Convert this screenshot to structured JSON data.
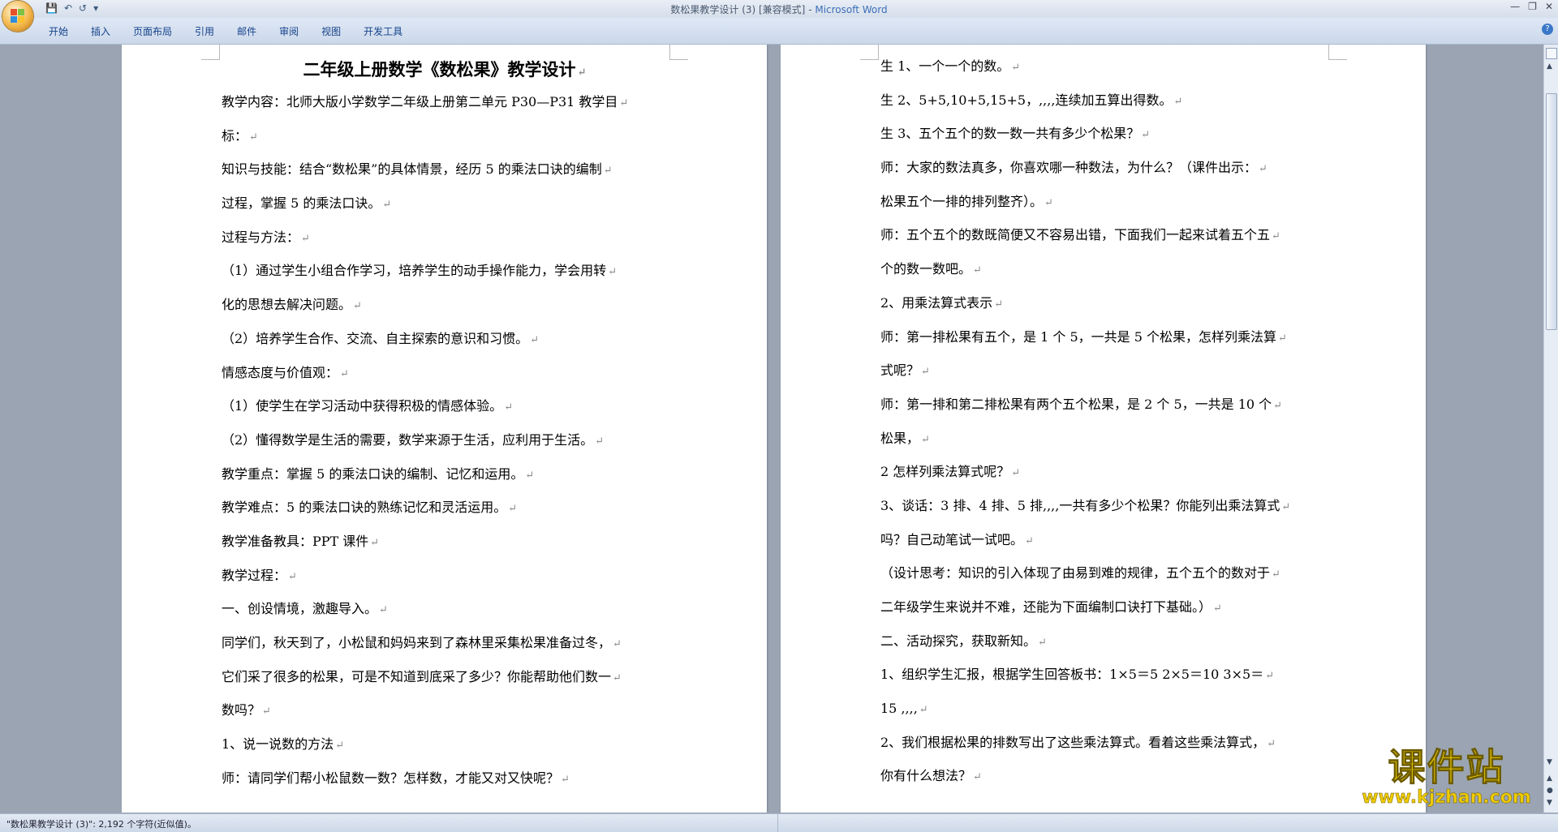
{
  "window": {
    "title": "数松果教学设计 (3) [兼容模式]",
    "separator": " - ",
    "app_name": "Microsoft Word"
  },
  "quick_access": {
    "save_icon": "save-icon",
    "undo_icon": "undo-icon",
    "redo_icon": "redo-icon",
    "customize_icon": "customize-icon"
  },
  "ribbon": {
    "tabs": [
      "开始",
      "插入",
      "页面布局",
      "引用",
      "邮件",
      "审阅",
      "视图",
      "开发工具"
    ]
  },
  "document": {
    "title": "二年级上册数学《数松果》教学设计",
    "left_lines": [
      " 教学内容：北师大版小学数学二年级上册第二单元 P30—P31 教学目",
      "标：",
      "知识与技能：结合“数松果”的具体情景，经历 5 的乘法口诀的编制",
      "过程，掌握 5 的乘法口诀。",
      "过程与方法：",
      "（1）通过学生小组合作学习，培养学生的动手操作能力，学会用转",
      "化的思想去解决问题。",
      "（2）培养学生合作、交流、自主探索的意识和习惯。",
      " 情感态度与价值观：",
      "（1）使学生在学习活动中获得积极的情感体验。",
      "（2）懂得数学是生活的需要，数学来源于生活，应利用于生活。",
      " 教学重点：掌握 5 的乘法口诀的编制、记忆和运用。",
      " 教学难点：5 的乘法口诀的熟练记忆和灵活运用。",
      "教学准备教具：PPT 课件",
      "教学过程：",
      "一、创设情境，激趣导入。",
      "同学们，秋天到了，小松鼠和妈妈来到了森林里采集松果准备过冬，",
      "它们采了很多的松果，可是不知道到底采了多少？你能帮助他们数一",
      "数吗？",
      "1、说一说数的方法",
      "师：请同学们帮小松鼠数一数？怎样数，才能又对又快呢？"
    ],
    "right_lines": [
      " 生 1、一个一个的数。",
      "生 2、5+5,10+5,15+5，,,,,连续加五算出得数。",
      "生 3、五个五个的数一数一共有多少个松果？",
      " 师：大家的数法真多，你喜欢哪一种数法，为什么？（课件出示：",
      "松果五个一排的排列整齐）。",
      "师：五个五个的数既简便又不容易出错，下面我们一起来试着五个五",
      "个的数一数吧。",
      "2、用乘法算式表示",
      "师：第一排松果有五个，是 1 个 5，一共是 5 个松果，怎样列乘法算",
      "式呢？",
      " 师：第一排和第二排松果有两个五个松果，是 2 个 5，一共是 10 个",
      "松果，",
      " 2 怎样列乘法算式呢？",
      "3、谈话：3 排、4 排、5 排,,,,一共有多少个松果？你能列出乘法算式",
      "吗？自己动笔试一试吧。",
      "（设计思考：知识的引入体现了由易到难的规律，五个五个的数对于",
      "二年级学生来说并不难，还能为下面编制口诀打下基础。）",
      "二、活动探究，获取新知。",
      "1、组织学生汇报，根据学生回答板书：1×5＝5   2×5＝10   3×5＝",
      "15 ,,,,",
      "2、我们根据松果的排数写出了这些乘法算式。看着这些乘法算式，",
      "你有什么想法？"
    ],
    "paragraph_mark": "↵"
  },
  "status_bar": {
    "text": "\"数松果教学设计 (3)\": 2,192 个字符(近似值)。"
  },
  "watermark": {
    "main": "课件站",
    "url": "www.kjzhan.com"
  },
  "colors": {
    "ribbon_tab_text": "#15428b",
    "app_name": "#3a6fb8",
    "watermark_yellow": "#f4d300"
  }
}
